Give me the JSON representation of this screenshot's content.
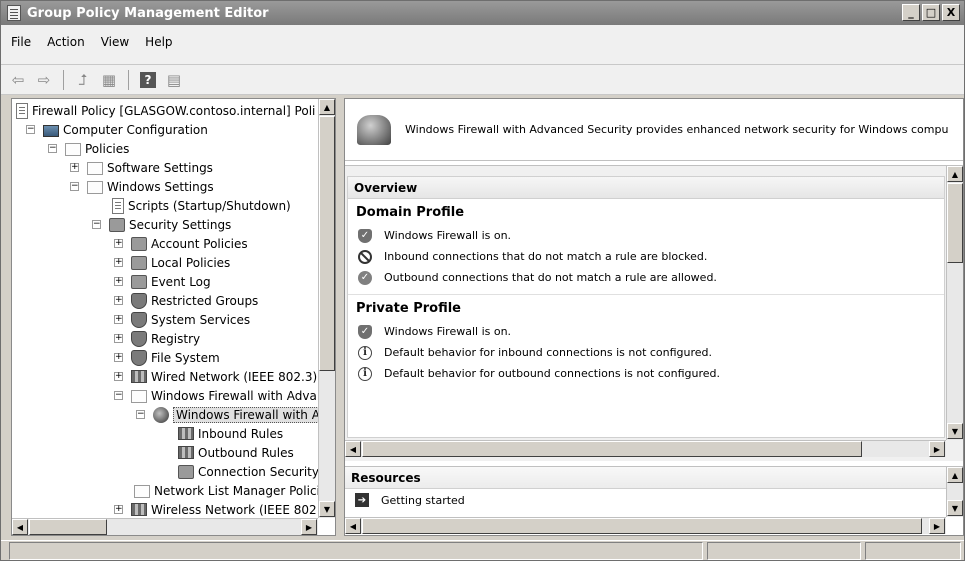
{
  "window": {
    "title": "Group Policy Management Editor",
    "controls": [
      "_",
      "□",
      "X"
    ]
  },
  "menu": [
    "File",
    "Action",
    "View",
    "Help"
  ],
  "toolbar": {
    "back_icon": "back-arrow-icon",
    "forward_icon": "forward-arrow-icon",
    "help_label": "?"
  },
  "tree": {
    "root": "Firewall Policy [GLASGOW.contoso.internal] Poli",
    "computer_configuration": "Computer Configuration",
    "policies": "Policies",
    "software_settings": "Software Settings",
    "windows_settings": "Windows Settings",
    "scripts": "Scripts (Startup/Shutdown)",
    "security_settings": "Security Settings",
    "account_policies": "Account Policies",
    "local_policies": "Local Policies",
    "event_log": "Event Log",
    "restricted_groups": "Restricted Groups",
    "system_services": "System Services",
    "registry": "Registry",
    "file_system": "File System",
    "wired_network": "Wired Network (IEEE 802.3)",
    "wf_adv_parent": "Windows Firewall with Adva",
    "wf_adv_child": "Windows Firewall with A",
    "inbound_rules": "Inbound Rules",
    "outbound_rules": "Outbound Rules",
    "connection_security": "Connection Security",
    "network_list": "Network List Manager Policie",
    "wireless_network": "Wireless Network (IEEE 802"
  },
  "header": {
    "text": "Windows Firewall with Advanced Security provides enhanced network security for Windows compu"
  },
  "overview": {
    "title": "Overview",
    "domain": {
      "title": "Domain Profile",
      "items": [
        "Windows Firewall is on.",
        "Inbound connections that do not match a rule are blocked.",
        "Outbound connections that do not match a rule are allowed."
      ]
    },
    "private": {
      "title": "Private Profile",
      "items": [
        "Windows Firewall is on.",
        "Default behavior for inbound connections is not configured.",
        "Default behavior for outbound connections is not configured."
      ]
    }
  },
  "resources": {
    "title": "Resources",
    "items": [
      "Getting started"
    ]
  }
}
